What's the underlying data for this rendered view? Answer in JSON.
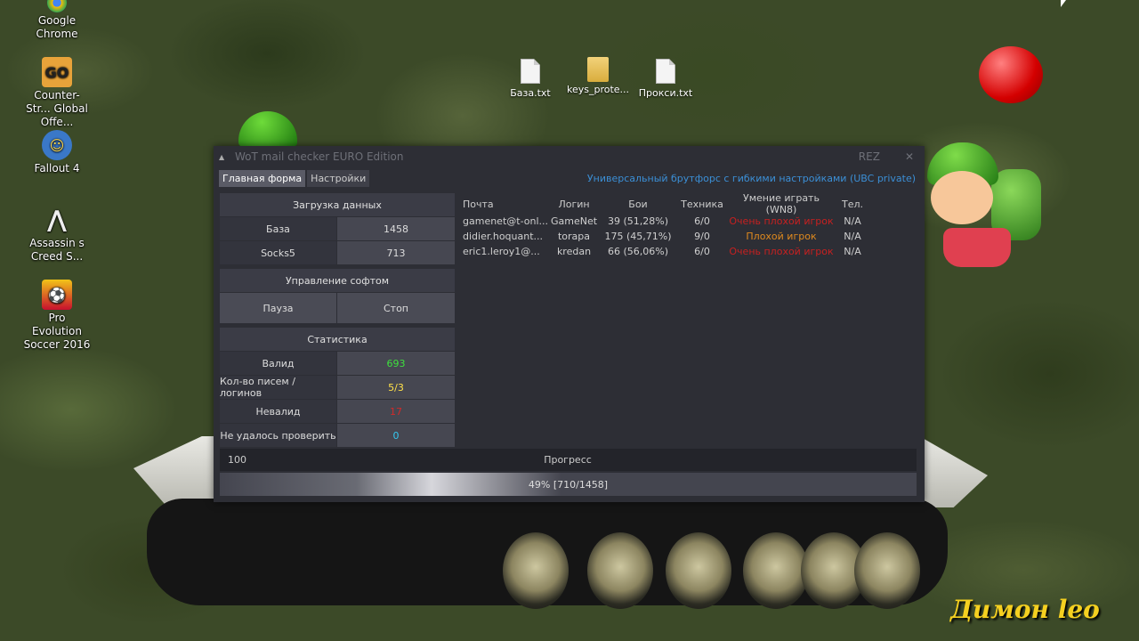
{
  "desktop": {
    "icons": [
      {
        "label": "Google Chrome"
      },
      {
        "label": "Counter-Str... Global Offe..."
      },
      {
        "label": "Fallout 4"
      },
      {
        "label": "Assassin s Creed S..."
      },
      {
        "label": "Pro Evolution Soccer 2016"
      }
    ],
    "files": [
      {
        "label": "База.txt"
      },
      {
        "label": "keys_prote..."
      },
      {
        "label": "Прокси.txt"
      }
    ],
    "signature": "Димон leo"
  },
  "app": {
    "title": "WoT mail checker EURO Edition",
    "rez": "REZ",
    "close": "✕",
    "tabs": [
      "Главная форма",
      "Настройки"
    ],
    "tagline": "Универсальный брутфорс с гибкими настройками (UBC private)",
    "load": {
      "title": "Загрузка данных",
      "base_label": "База",
      "base_value": "1458",
      "socks_label": "Socks5",
      "socks_value": "713"
    },
    "control": {
      "title": "Управление софтом",
      "pause": "Пауза",
      "stop": "Стоп"
    },
    "stats": {
      "title": "Статистика",
      "valid_label": "Валид",
      "valid_value": "693",
      "mails_label": "Кол-во писем / логинов",
      "mails_value": "5/3",
      "invalid_label": "Невалид",
      "invalid_value": "17",
      "failed_label": "Не удалось проверить",
      "failed_value": "0"
    },
    "table": {
      "headers": [
        "Почта",
        "Логин",
        "Бои",
        "Техника",
        "Умение играть (WN8)",
        "Тел."
      ],
      "rows": [
        {
          "mail": "gamenet@t-onl...",
          "login": "GameNet",
          "battles": "39 (51,28%)",
          "tech": "6/0",
          "skill": "Очень плохой игрок",
          "phone": "N/A"
        },
        {
          "mail": "didier.hoquant...",
          "login": "torapa",
          "battles": "175 (45,71%)",
          "tech": "9/0",
          "skill": "Плохой игрок",
          "phone": "N/A"
        },
        {
          "mail": "eric1.leroy1@...",
          "login": "kredan",
          "battles": "66 (56,06%)",
          "tech": "6/0",
          "skill": "Очень плохой игрок",
          "phone": "N/A"
        }
      ]
    },
    "progress": {
      "count": "100",
      "title": "Прогресс",
      "text": "49% [710/1458]",
      "fraction": 0.49
    }
  },
  "colors": {
    "valid": "#3ee03e",
    "mails": "#ffe14a",
    "invalid": "#d22a2a",
    "failed": "#34c8f0",
    "skill_very_bad": "#c82020",
    "skill_bad": "#e08a1e",
    "accent_link": "#3b8fd6"
  }
}
